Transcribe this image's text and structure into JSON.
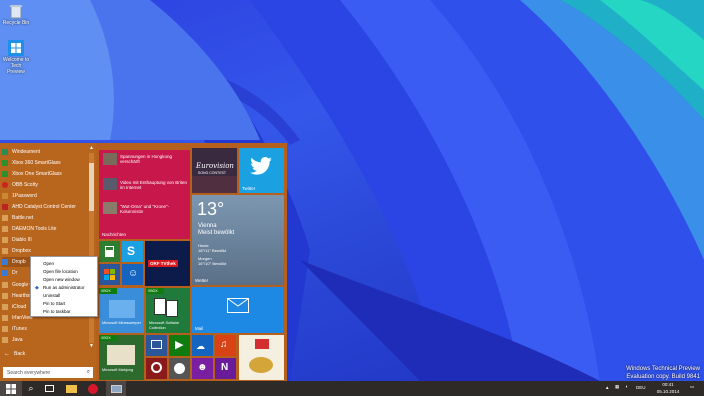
{
  "desktop": {
    "icons": [
      {
        "label": "Recycle Bin",
        "icon": "recycle-bin-icon"
      },
      {
        "label": "Welcome to Tech Preview",
        "icon": "windows-icon"
      }
    ],
    "watermark": {
      "line1": "Windows Technical Preview",
      "line2": "Evaluation copy. Build 9841"
    }
  },
  "start_menu": {
    "apps": [
      {
        "label": "Windeament",
        "color": "#2e8b57"
      },
      {
        "label": "Xbox 360 SmartGlass",
        "color": "#2f8f2f"
      },
      {
        "label": "Xbox One SmartGlass",
        "color": "#2f8f2f"
      },
      {
        "label": "OBB Scotty",
        "color": "#cc2222"
      },
      {
        "label": "1Password",
        "color": "#cc8833"
      },
      {
        "label": "AHD Catalyst Control Center",
        "color": "#bb2222"
      },
      {
        "label": "Battle.net",
        "color": "#c98b3a"
      },
      {
        "label": "DAEMON Tools Lite",
        "color": "#c98b3a"
      },
      {
        "label": "Diablo III",
        "color": "#c98b3a"
      },
      {
        "label": "Dropbox",
        "color": "#c98b3a"
      },
      {
        "label": "Dropb",
        "color": "#3a7bd5"
      },
      {
        "label": "Dr",
        "color": "#3a7bd5"
      },
      {
        "label": "Google C",
        "color": "#c98b3a"
      },
      {
        "label": "Hearthsto",
        "color": "#c98b3a"
      },
      {
        "label": "iCloud",
        "color": "#c98b3a"
      },
      {
        "label": "IrfanView",
        "color": "#c98b3a"
      },
      {
        "label": "iTunes",
        "color": "#c98b3a"
      },
      {
        "label": "Java",
        "color": "#c98b3a"
      },
      {
        "label": "Microsoft",
        "color": "#c98b3a"
      },
      {
        "label": "Microsoft",
        "color": "#c98b3a"
      },
      {
        "label": "Back",
        "color": ""
      }
    ],
    "back_label": "Back",
    "search_placeholder": "Search everywhere",
    "news_tile": {
      "items": [
        "Spannungen in Hongkong verschärft",
        "Video mit Enthauptung von Briten im Internet",
        "\"Wut-Oma\" und \"Krone\"-Kolumnistin"
      ],
      "label": "Nachrichten"
    },
    "eurovision_tile": {
      "text": "Eurovision",
      "sub": "SONG CONTEST"
    },
    "twitter_tile": {
      "label": "Twitter"
    },
    "weather_tile": {
      "temp": "13°",
      "city": "Vienna",
      "condition": "Meist bewölkt",
      "today_label": "Heute",
      "today": "18°/11° Bewölkt",
      "tomorrow_label": "Morgen",
      "tomorrow": "16°/10° Bewölkt",
      "label": "Wetter"
    },
    "mail_tile": {
      "label": "Mail"
    },
    "orf_tile": {
      "text": "ORF TVthek"
    },
    "minesweeper_tile": {
      "label": "Microsoft Minesweeper",
      "badge": "XBOX"
    },
    "solitaire_tile": {
      "label": "Microsoft Solitaire Collection",
      "badge": "XBOX"
    },
    "mahjong_tile": {
      "label": "Microsoft Mahjong",
      "badge": "XBOX"
    },
    "context_menu": [
      "Open",
      "Open file location",
      "Open new window",
      "Run as administrator",
      "Uninstall",
      "Pin to Start",
      "Pin to taskbar"
    ]
  },
  "taskbar": {
    "language": "DEU",
    "time": "00:41",
    "date": "05.10.2014"
  },
  "colors": {
    "start_bg": "#b5611d",
    "accent_red": "#c8174a",
    "taskbar": "#2e2a28"
  }
}
